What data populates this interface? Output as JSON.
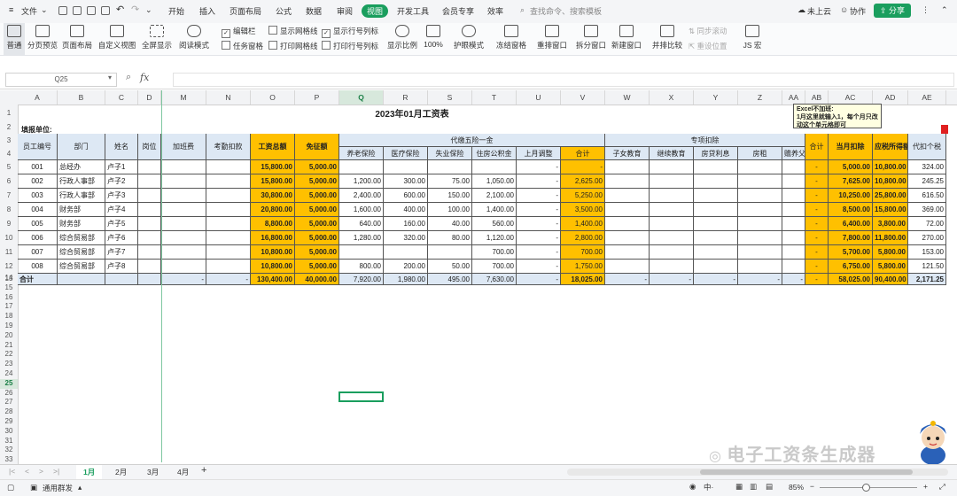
{
  "menubar": {
    "file": "文件",
    "tabs": [
      "开始",
      "插入",
      "页面布局",
      "公式",
      "数据",
      "审阅",
      "视图",
      "开发工具",
      "会员专享",
      "效率"
    ],
    "active_tab": "视图",
    "search_placeholder": "查找命令、搜索模板",
    "cloud": "未上云",
    "collab": "协作",
    "share": "分享"
  },
  "ribbon": {
    "buttons": [
      "普通",
      "分页预览",
      "页面布局",
      "自定义视图",
      "全屏显示",
      "阅读模式",
      "显示比例",
      "100%",
      "护眼模式",
      "冻结窗格",
      "重排窗口",
      "拆分窗口",
      "新建窗口",
      "并排比较",
      "JS 宏"
    ],
    "checks": [
      "编辑栏",
      "显示网格线",
      "显示行号列标",
      "任务窗格",
      "打印网格线",
      "打印行号列标"
    ],
    "disabled": [
      "同步滚动",
      "重设位置"
    ]
  },
  "formula": {
    "namebox": "Q25",
    "fx": "fx"
  },
  "columns": [
    "A",
    "B",
    "C",
    "D",
    "M",
    "N",
    "O",
    "P",
    "Q",
    "R",
    "S",
    "T",
    "U",
    "V",
    "W",
    "X",
    "Y",
    "Z",
    "AA",
    "AB",
    "AC",
    "AD",
    "AE"
  ],
  "selected_column": "Q",
  "selected_row": "25",
  "sheet": {
    "title": "2023年01月工资表",
    "unit_label": "填报单位:",
    "comment": "Excel不加班:\n1月这里就输入1，每个月只改动这个单元格即可",
    "headers": {
      "emp_id": "员工编号",
      "dept": "部门",
      "name": "姓名",
      "post": "岗位",
      "overtime": "加班费",
      "attendance": "考勤扣款",
      "gross": "工资总额",
      "exempt": "免征额",
      "insurance_group": "代缴五险一金",
      "pension": "养老保险",
      "medical": "医疗保险",
      "unemployment": "失业保险",
      "housing": "住房公积金",
      "last_month": "上月调整",
      "subtotal": "合计",
      "special_group": "专项扣除",
      "child_edu": "子女教育",
      "cont_edu": "继续教育",
      "mortgage": "房贷利息",
      "rent": "房租",
      "elderly": "赡养父母",
      "special_total": "合计",
      "month_deduct": "当月扣除",
      "taxable": "应税所得额",
      "tax": "代扣个税"
    },
    "rows": [
      {
        "row": "5",
        "id": "001",
        "dept": "总经办",
        "name": "卢子1",
        "gross": "15,800.00",
        "exempt": "5,000.00",
        "pension": "",
        "medical": "",
        "unemployment": "",
        "housing": "",
        "last": "-",
        "subtotal": "-",
        "sp": "-",
        "month": "5,000.00",
        "taxable": "10,800.00",
        "tax": "324.00"
      },
      {
        "row": "6",
        "id": "002",
        "dept": "行政人事部",
        "name": "卢子2",
        "gross": "15,800.00",
        "exempt": "5,000.00",
        "pension": "1,200.00",
        "medical": "300.00",
        "unemployment": "75.00",
        "housing": "1,050.00",
        "last": "-",
        "subtotal": "2,625.00",
        "sp": "-",
        "month": "7,625.00",
        "taxable": "10,800.00",
        "tax": "245.25"
      },
      {
        "row": "7",
        "id": "003",
        "dept": "行政人事部",
        "name": "卢子3",
        "gross": "30,800.00",
        "exempt": "5,000.00",
        "pension": "2,400.00",
        "medical": "600.00",
        "unemployment": "150.00",
        "housing": "2,100.00",
        "last": "-",
        "subtotal": "5,250.00",
        "sp": "-",
        "month": "10,250.00",
        "taxable": "25,800.00",
        "tax": "616.50"
      },
      {
        "row": "8",
        "id": "004",
        "dept": "财务部",
        "name": "卢子4",
        "gross": "20,800.00",
        "exempt": "5,000.00",
        "pension": "1,600.00",
        "medical": "400.00",
        "unemployment": "100.00",
        "housing": "1,400.00",
        "last": "-",
        "subtotal": "3,500.00",
        "sp": "-",
        "month": "8,500.00",
        "taxable": "15,800.00",
        "tax": "369.00"
      },
      {
        "row": "9",
        "id": "005",
        "dept": "财务部",
        "name": "卢子5",
        "gross": "8,800.00",
        "exempt": "5,000.00",
        "pension": "640.00",
        "medical": "160.00",
        "unemployment": "40.00",
        "housing": "560.00",
        "last": "-",
        "subtotal": "1,400.00",
        "sp": "-",
        "month": "6,400.00",
        "taxable": "3,800.00",
        "tax": "72.00"
      },
      {
        "row": "10",
        "id": "006",
        "dept": "综合贸易部",
        "name": "卢子6",
        "gross": "16,800.00",
        "exempt": "5,000.00",
        "pension": "1,280.00",
        "medical": "320.00",
        "unemployment": "80.00",
        "housing": "1,120.00",
        "last": "-",
        "subtotal": "2,800.00",
        "sp": "-",
        "month": "7,800.00",
        "taxable": "11,800.00",
        "tax": "270.00"
      },
      {
        "row": "11",
        "id": "007",
        "dept": "综合贸易部",
        "name": "卢子7",
        "gross": "10,800.00",
        "exempt": "5,000.00",
        "pension": "",
        "medical": "",
        "unemployment": "",
        "housing": "700.00",
        "last": "-",
        "subtotal": "700.00",
        "sp": "-",
        "month": "5,700.00",
        "taxable": "5,800.00",
        "tax": "153.00"
      },
      {
        "row": "12",
        "id": "008",
        "dept": "综合贸易部",
        "name": "卢子8",
        "gross": "10,800.00",
        "exempt": "5,000.00",
        "pension": "800.00",
        "medical": "200.00",
        "unemployment": "50.00",
        "housing": "700.00",
        "last": "-",
        "subtotal": "1,750.00",
        "sp": "-",
        "month": "6,750.00",
        "taxable": "5,800.00",
        "tax": "121.50"
      }
    ],
    "total": {
      "label": "合计",
      "overtime": "-",
      "attendance": "-",
      "gross": "130,400.00",
      "exempt": "40,000.00",
      "pension": "7,920.00",
      "medical": "1,980.00",
      "unemployment": "495.00",
      "housing": "7,630.00",
      "last": "-",
      "subtotal": "18,025.00",
      "child": "-",
      "cont": "-",
      "mortgage": "-",
      "rent": "-",
      "elderly": "-",
      "sp": "-",
      "month": "58,025.00",
      "taxable": "90,400.00",
      "tax": "2,171.25"
    }
  },
  "sheet_tabs": [
    "1月",
    "2月",
    "3月",
    "4月"
  ],
  "active_sheet": "1月",
  "status": {
    "macro": "通用群发",
    "zoom": "85%"
  },
  "watermark": "电子工资条生成器",
  "colors": {
    "accent": "#1a9e5e",
    "orange": "#ffc000",
    "light_blue": "#dde8f4"
  }
}
